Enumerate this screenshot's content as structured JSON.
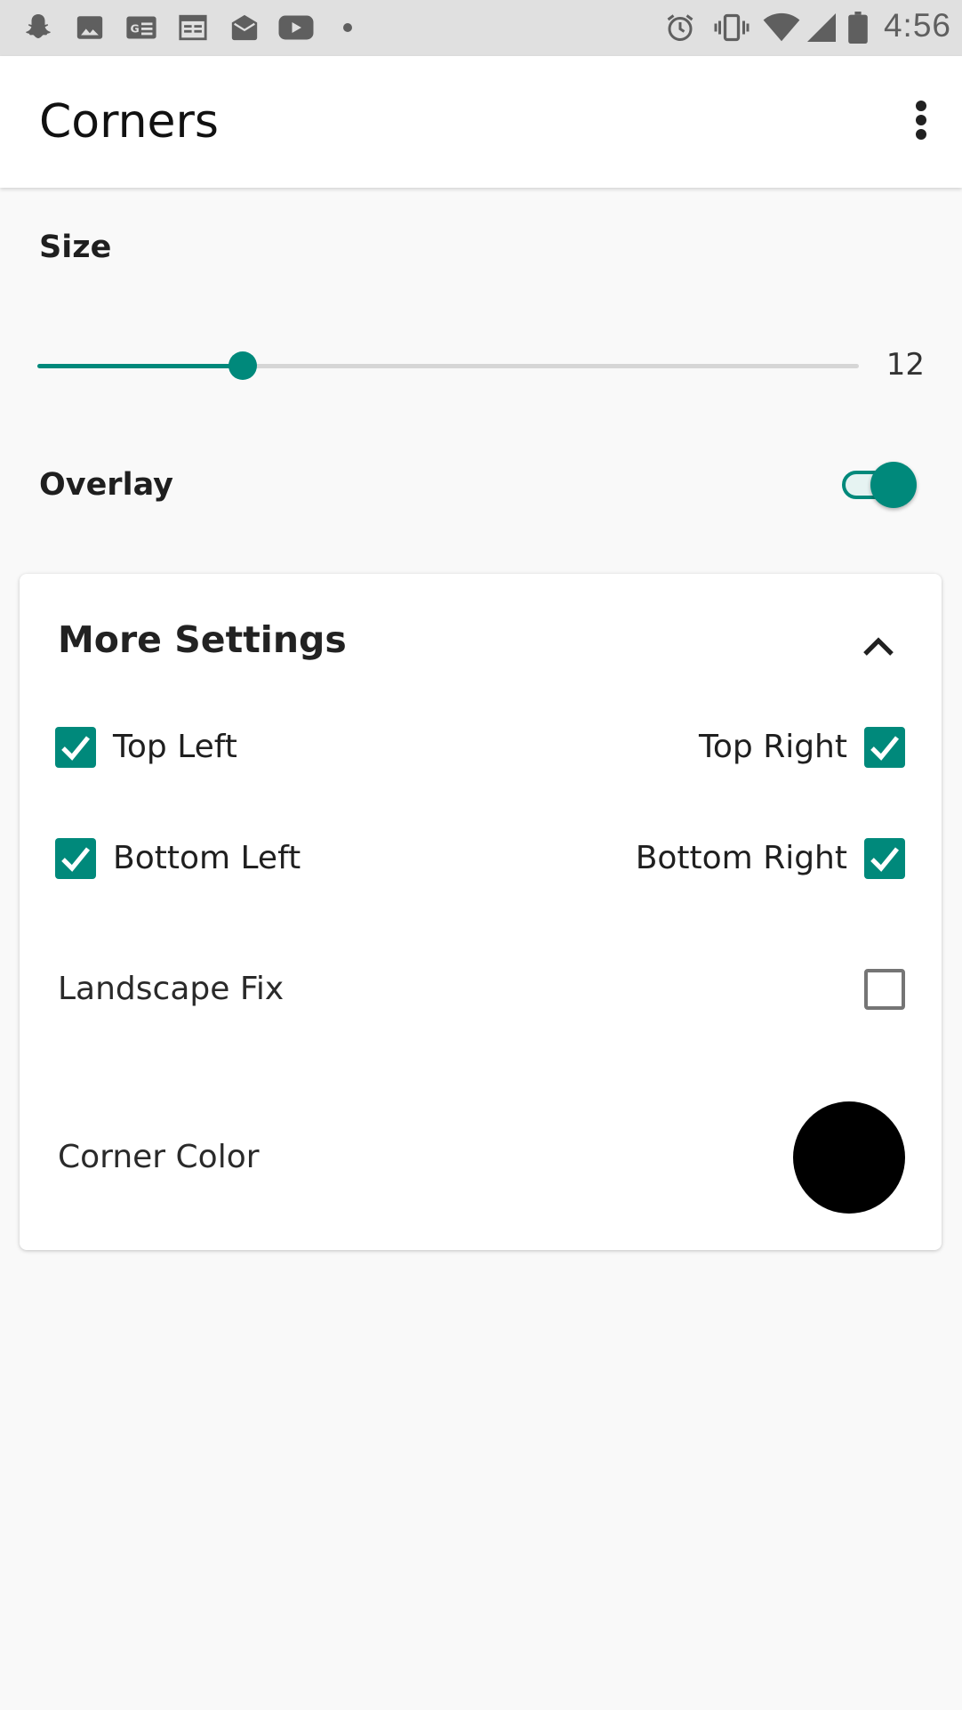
{
  "status_bar": {
    "time": "4:56",
    "left_icons": [
      "snapchat-icon",
      "gallery-icon",
      "news-icon",
      "calendar-icon",
      "inbox-icon",
      "youtube-icon",
      "dot-icon"
    ],
    "right_icons": [
      "alarm-icon",
      "vibrate-icon",
      "wifi-icon",
      "signal-icon",
      "battery-icon"
    ]
  },
  "app_bar": {
    "title": "Corners",
    "menu_icon": "more-vert-icon"
  },
  "size": {
    "label": "Size",
    "value": "12",
    "slider_fraction": 0.25
  },
  "overlay": {
    "label": "Overlay",
    "enabled": true
  },
  "more_settings": {
    "title": "More Settings",
    "expanded": true,
    "corners": {
      "top_left": {
        "label": "Top Left",
        "checked": true
      },
      "top_right": {
        "label": "Top Right",
        "checked": true
      },
      "bottom_left": {
        "label": "Bottom Left",
        "checked": true
      },
      "bottom_right": {
        "label": "Bottom Right",
        "checked": true
      }
    },
    "landscape_fix": {
      "label": "Landscape Fix",
      "checked": false
    },
    "corner_color": {
      "label": "Corner Color",
      "color": "#000000"
    }
  },
  "colors": {
    "accent": "#00897b",
    "status_bar": "#e0e0e0",
    "background": "#f9f9f9"
  }
}
